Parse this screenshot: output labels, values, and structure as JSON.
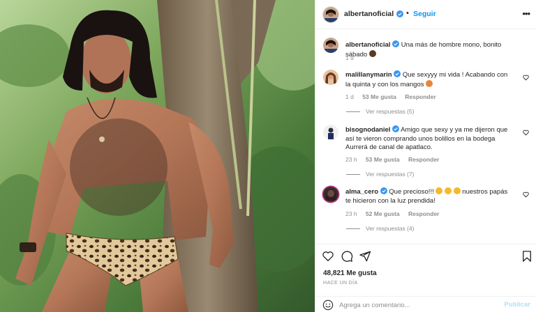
{
  "post": {
    "username": "albertanoficial",
    "follow_label": "Seguir",
    "separator": "•",
    "more_label": "•••",
    "caption": "Una más de hombre mono, bonito sábado",
    "caption_time": "1 d"
  },
  "comments": [
    {
      "username": "malillanymarin",
      "verified": true,
      "text": "Que sexyyy mi vida ! Acabando con la quinta y con los mangos",
      "time": "1 d",
      "likes": "53 Me gusta",
      "reply_label": "Responder",
      "view_replies": "Ver respuestas (5)"
    },
    {
      "username": "bisognodaniel",
      "verified": true,
      "text": "Amigo que sexy y ya me dijeron que así te vieron comprando unos bolillos en la bodega Aurrerá de canal de apatlaco.",
      "time": "23 h",
      "likes": "53 Me gusta",
      "reply_label": "Responder",
      "view_replies": "Ver respuestas (7)"
    },
    {
      "username": "alma_cero",
      "verified": true,
      "text_before": "Que precioso!!!",
      "text_after": "nuestros papás te hicieron con la luz prendida!",
      "time": "23 h",
      "likes": "52 Me gusta",
      "reply_label": "Responder",
      "view_replies": "Ver respuestas (4)"
    }
  ],
  "footer": {
    "likes_count": "48,821",
    "likes_suffix": "Me gusta",
    "time_ago": "HACE UN DÍA",
    "comment_placeholder": "Agrega un comentario...",
    "publish_label": "Publicar"
  },
  "icons": {
    "heart": "heart-icon",
    "comment": "comment-icon",
    "share": "share-icon",
    "save": "bookmark-icon",
    "emoji": "smile-icon",
    "verified": "verified-badge-icon"
  },
  "colors": {
    "link_blue": "#0095f6",
    "verified_blue": "#3897f0",
    "muted": "#8e8e8e",
    "publish_disabled": "#b2dffc"
  }
}
